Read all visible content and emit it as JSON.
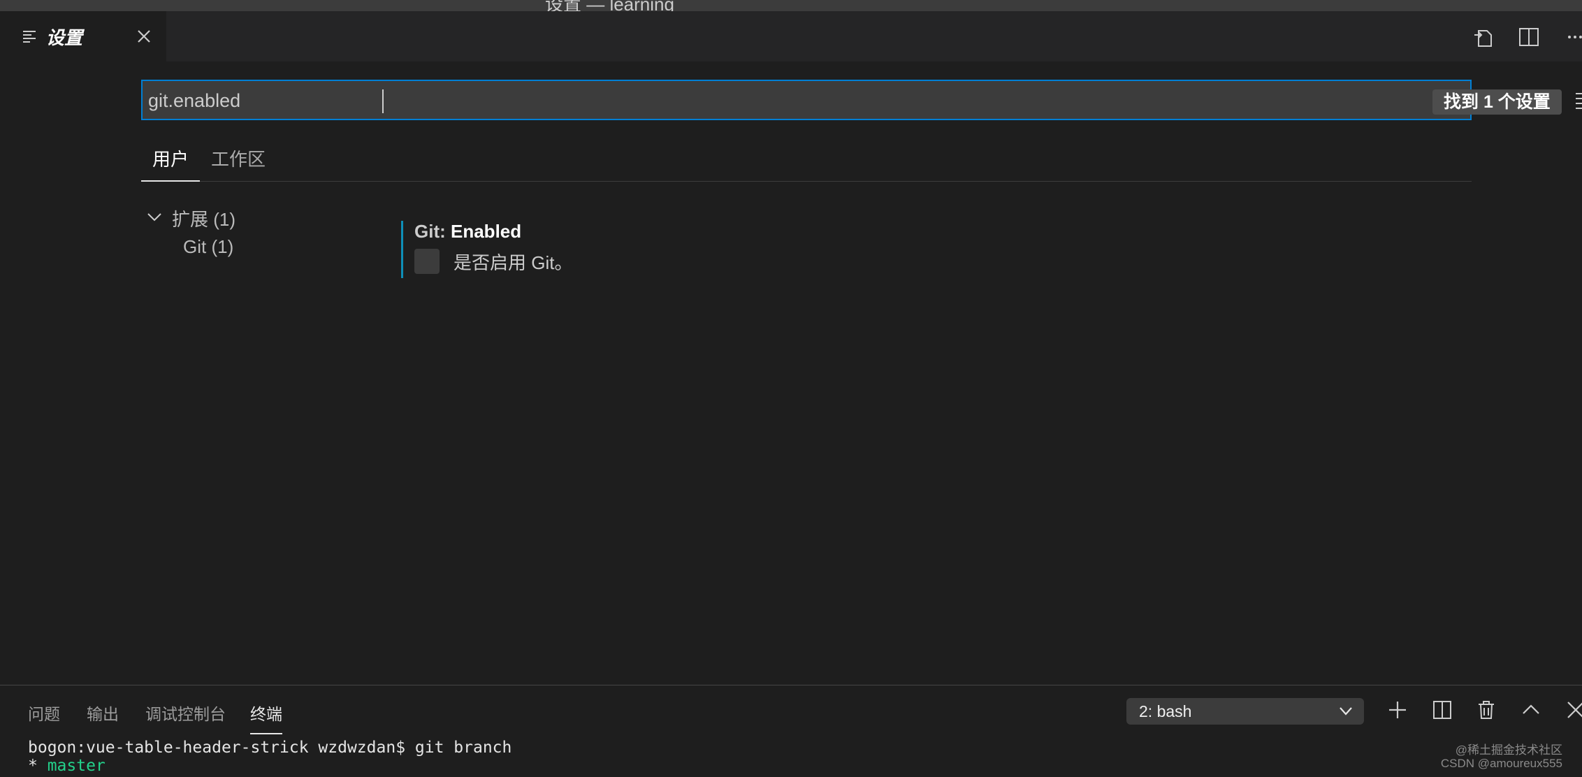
{
  "window": {
    "title": "设置 — learning"
  },
  "tab": {
    "label": "设置"
  },
  "search": {
    "value": "git.enabled",
    "result_count": "找到 1 个设置"
  },
  "scopes": [
    {
      "label": "用户",
      "active": true
    },
    {
      "label": "工作区",
      "active": false
    }
  ],
  "toc": {
    "group": "扩展 (1)",
    "child": "Git (1)"
  },
  "setting": {
    "category": "Git: ",
    "name": "Enabled",
    "description": "是否启用 Git。",
    "checked": false
  },
  "panel": {
    "tabs": [
      {
        "label": "问题"
      },
      {
        "label": "输出"
      },
      {
        "label": "调试控制台"
      },
      {
        "label": "终端",
        "active": true
      }
    ],
    "terminal_select": "2: bash"
  },
  "terminal": {
    "prompt_line": "bogon:vue-table-header-strick wzdwzdan$ git branch",
    "branch_prefix": "* ",
    "branch_name": "master"
  },
  "watermark": {
    "line1": "@稀土掘金技术社区",
    "line2": "CSDN @amoureux555"
  },
  "colors": {
    "accent": "#007fd4",
    "setting_indicator": "#0e8fb8",
    "terminal_branch": "#23d18b"
  }
}
